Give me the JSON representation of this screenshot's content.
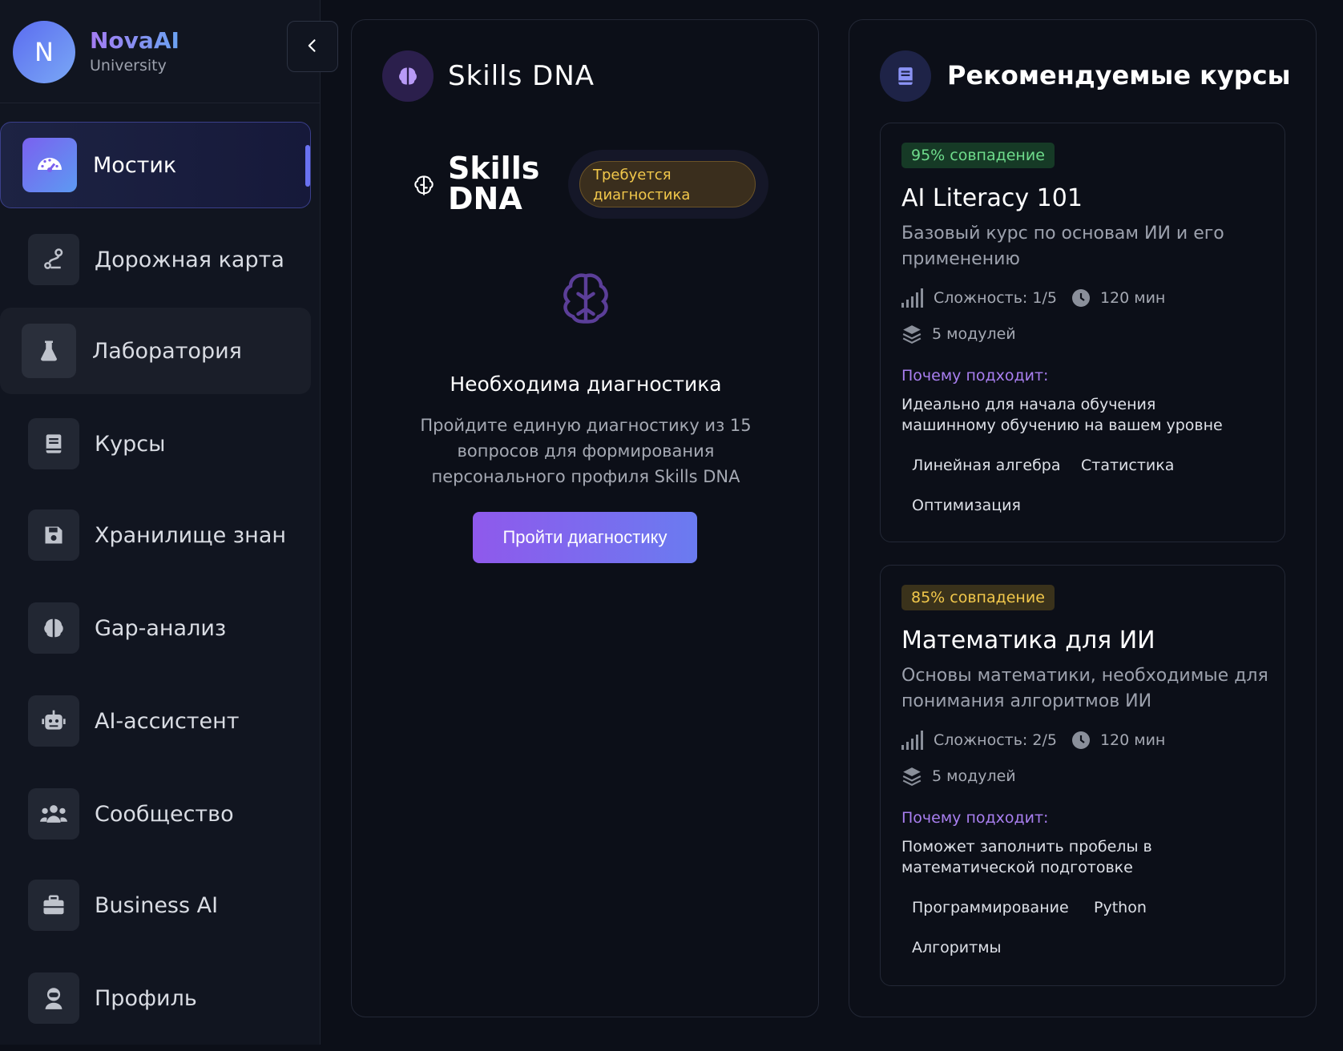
{
  "sidebar": {
    "brand_initial": "N",
    "brand_name": "NovaAI",
    "brand_sub": "University",
    "items": [
      {
        "label": "Мостик",
        "icon": "gauge-icon"
      },
      {
        "label": "Дорожная карта",
        "icon": "route-icon"
      },
      {
        "label": "Лаборатория",
        "icon": "flask-icon"
      },
      {
        "label": "Курсы",
        "icon": "book-icon"
      },
      {
        "label": "Хранилище знаний",
        "icon": "save-icon"
      },
      {
        "label": "Gap-анализ",
        "icon": "brain-icon"
      },
      {
        "label": "AI-ассистент",
        "icon": "robot-icon"
      },
      {
        "label": "Сообщество",
        "icon": "users-icon"
      },
      {
        "label": "Business AI",
        "icon": "briefcase-icon"
      },
      {
        "label": "Профиль",
        "icon": "user-astronaut-icon"
      }
    ]
  },
  "skills": {
    "title": "Skills DNA",
    "label": "Skills DNA",
    "badge": "Требуется диагностика",
    "need_title": "Необходима диагностика",
    "need_desc": "Пройдите единую диагностику из 15 вопросов для формирования персонального профиля Skills DNA",
    "button": "Пройти диагностику"
  },
  "recommended": {
    "title": "Рекомендуемые курсы",
    "why_label": "Почему подходит:",
    "courses": [
      {
        "match": "95% совпадение",
        "title": "AI Literacy 101",
        "desc": "Базовый курс по основам ИИ и его применению",
        "difficulty": "Сложность: 1/5",
        "duration": "120 мин",
        "modules": "5 модулей",
        "why": "Идеально для начала обучения машинному обучению на вашем уровне",
        "tags": [
          "Линейная алгебра",
          "Статистика",
          "Оптимизация"
        ]
      },
      {
        "match": "85% совпадение",
        "title": "Математика для ИИ",
        "desc": "Основы математики, необходимые для понимания алгоритмов ИИ",
        "difficulty": "Сложность: 2/5",
        "duration": "120 мин",
        "modules": "5 модулей",
        "why": "Поможет заполнить пробелы в математической подготовке",
        "tags": [
          "Программирование",
          "Python",
          "Алгоритмы"
        ]
      }
    ]
  },
  "colors": {
    "accent": "#7a61ef",
    "match_high_bg": "#163a26",
    "match_high_text": "#6fdc8c",
    "match_mid_bg": "#3a321b",
    "match_mid_text": "#f2c84b"
  }
}
